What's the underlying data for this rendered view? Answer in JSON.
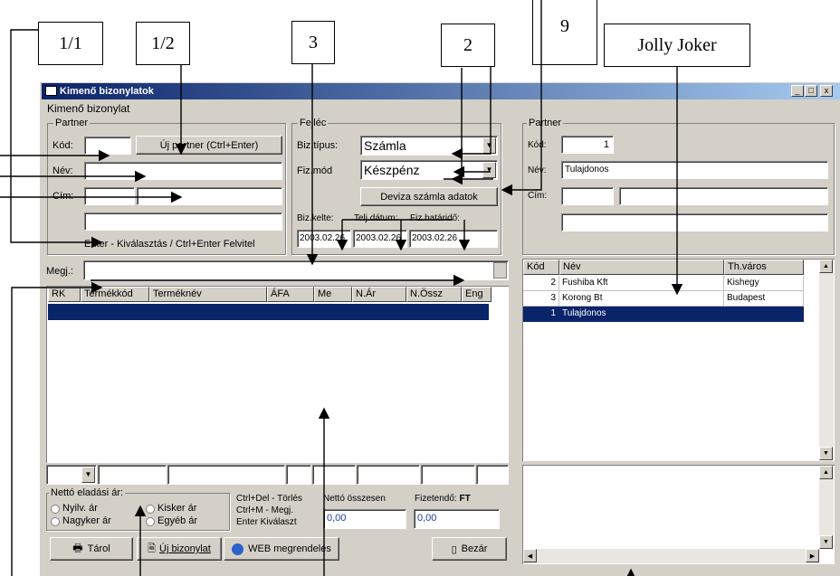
{
  "callouts": [
    "1/1",
    "1/2",
    "3",
    "2",
    "9",
    "Jolly Joker"
  ],
  "window": {
    "title": "Kimenő bizonylatok",
    "min": "_",
    "max": "□",
    "close": "x"
  },
  "left": {
    "group_title": "Kimenő bizonylat",
    "partner": {
      "title": "Partner",
      "kod_label": "Kód:",
      "kod_value": "",
      "new_partner_button": "Új partner (Ctrl+Enter)",
      "nev_label": "Név:",
      "cim_label": "Cím:",
      "hint": "Enter - Kiválasztás  /  Ctrl+Enter Felvitel"
    },
    "fejlec": {
      "title": "Fejléc",
      "biz_tipus_label": "Biz.típus:",
      "biz_tipus_value": "Számla",
      "fiz_mod_label": "Fiz.mód",
      "fiz_mod_value": "Készpénz",
      "deviza_button": "Deviza számla adatok",
      "biz_kelte_label": "Biz.kelte:",
      "telj_datum_label": "Telj.dátum:",
      "fiz_hatarido_label": "Fiz.határidő:",
      "biz_kelte_value": "2003.02.26",
      "telj_datum_value": "2003.02.26",
      "fiz_hatarido_value": "2003.02.26"
    },
    "megj_label": "Megj.:",
    "items_columns": [
      "RK",
      "Termékkód",
      "Terméknév",
      "ÁFA",
      "Me",
      "N.Ár",
      "N.Össz",
      "Eng"
    ],
    "netto_group": {
      "title": "Nettó eladási ár:",
      "options": [
        "Nyilv. ár",
        "Kisker ár",
        "Nagyker ár",
        "Egyéb ár"
      ]
    },
    "shortcuts": [
      "Ctrl+Del - Törlés",
      "Ctrl+M - Megj.",
      "Enter Kiválaszt"
    ],
    "netto_osszesen_label": "Nettó összesen",
    "netto_osszesen_value": "0,00",
    "fizetendo_label": "Fizetendő:",
    "fizetendo_currency": "FT",
    "fizetendo_value": "0,00",
    "buttons": {
      "tarol": "Tárol",
      "uj_bizonylat": "Új bizonylat",
      "web": "WEB megrendelés",
      "bezar": "Bezár"
    }
  },
  "right": {
    "partner": {
      "title": "Partner",
      "kod_label": "Kód:",
      "kod_value": "1",
      "nev_label": "Név:",
      "nev_value": "Tulajdonos",
      "cim_label": "Cím:"
    },
    "grid_columns": [
      "Kód",
      "Név",
      "Th.város"
    ],
    "rows": [
      {
        "kod": "2",
        "nev": "Fushiba Kft",
        "varos": "Kishegy"
      },
      {
        "kod": "3",
        "nev": "Korong Bt",
        "varos": "Budapest"
      },
      {
        "kod": "1",
        "nev": "Tulajdonos",
        "varos": ""
      }
    ]
  },
  "colors": {
    "face": "#d4d0c8",
    "selection": "#0a246a",
    "title_start": "#0a246a",
    "title_end": "#a6caf0"
  }
}
